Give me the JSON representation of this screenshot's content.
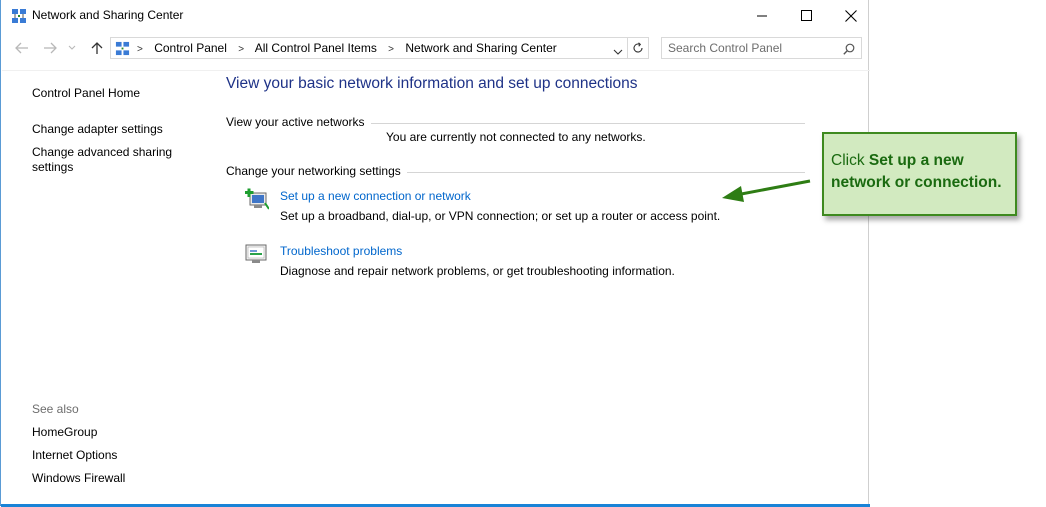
{
  "window": {
    "title": "Network and Sharing Center"
  },
  "address": {
    "crumbs": [
      "Control Panel",
      "All Control Panel Items",
      "Network and Sharing Center"
    ],
    "search_placeholder": "Search Control Panel"
  },
  "sidebar": {
    "links": [
      "Control Panel Home",
      "Change adapter settings",
      "Change advanced sharing settings"
    ],
    "see_also_label": "See also",
    "see_also": [
      "HomeGroup",
      "Internet Options",
      "Windows Firewall"
    ]
  },
  "main": {
    "heading": "View your basic network information and set up connections",
    "active_networks_label": "View your active networks",
    "not_connected": "You are currently not connected to any networks.",
    "change_settings_label": "Change your networking settings",
    "tasks": [
      {
        "link": "Set up a new connection or network",
        "desc": "Set up a broadband, dial-up, or VPN connection; or set up a router or access point."
      },
      {
        "link": "Troubleshoot problems",
        "desc": "Diagnose and repair network problems, or get troubleshooting information."
      }
    ]
  },
  "callout": {
    "prefix": "Click",
    "bold": "Set up a new network or connection."
  },
  "colors": {
    "heading": "#1e3287",
    "link": "#0066cc",
    "callout_bg": "#d2eac0",
    "callout_border": "#3e8a1f",
    "accent": "#1883d7"
  },
  "icons": [
    "network-center-icon",
    "minimize-icon",
    "maximize-icon",
    "close-icon",
    "back-arrow-icon",
    "forward-arrow-icon",
    "recent-dropdown-icon",
    "up-arrow-icon",
    "refresh-icon",
    "search-icon",
    "new-connection-icon",
    "troubleshoot-icon"
  ]
}
